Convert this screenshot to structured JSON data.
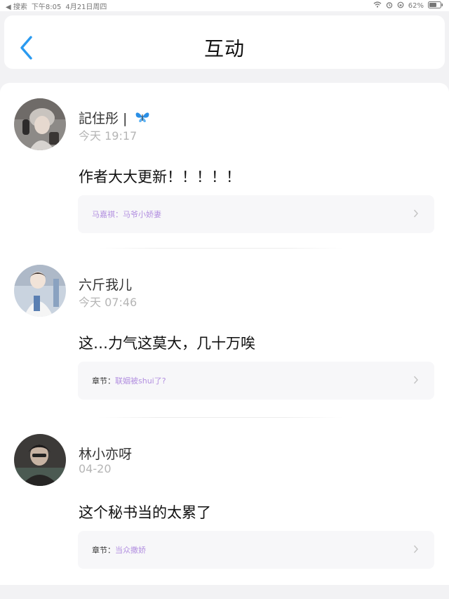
{
  "status_bar": {
    "back_app": "◀ 搜索",
    "time": "下午8:05",
    "date": "4月21日周四",
    "battery": "62%"
  },
  "header": {
    "title": "互动"
  },
  "comments": [
    {
      "username": "記住彤 |",
      "time": "今天 19:17",
      "text": "作者大大更新！！！！！",
      "ref_prefix": "",
      "ref_value": "马嘉祺：马爷小娇妻"
    },
    {
      "username": "六斤我儿",
      "time": "今天 07:46",
      "text": "这…力气这莫大，几十万唉",
      "ref_prefix": "章节：",
      "ref_value": "联姻被shui了?"
    },
    {
      "username": "林小亦呀",
      "time": "04-20",
      "text": "这个秘书当的太累了",
      "ref_prefix": "章节：",
      "ref_value": "当众撒娇"
    }
  ],
  "icons": {
    "back": "chevron-left-icon",
    "forward": "chevron-right-icon",
    "wifi": "wifi-icon",
    "battery": "battery-icon",
    "butterfly": "butterfly-icon"
  },
  "colors": {
    "accent_blue": "#2a9af0",
    "ref_purple": "#b28fe0",
    "timestamp_gray": "#b5b5b5"
  }
}
